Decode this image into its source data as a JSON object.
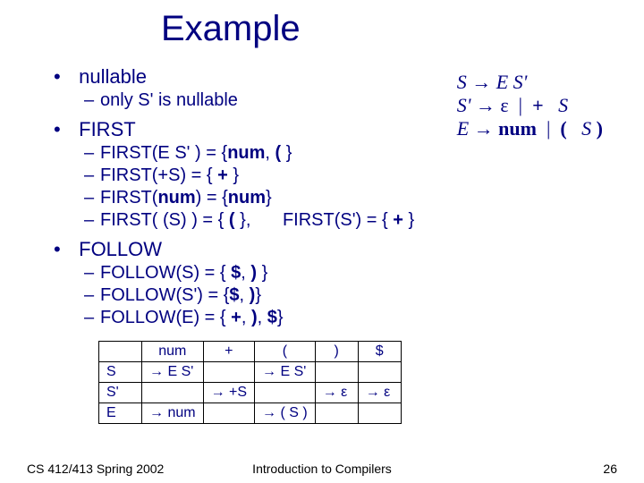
{
  "title": "Example",
  "grammar": {
    "line1_lhs": "S",
    "line1_rhs": "E S'",
    "line2_lhs": "S'",
    "line2_rhs1": "ε",
    "line2_rhs2": "+  S",
    "line3_lhs": "E",
    "line3_rhs1": "num",
    "line3_rhs2": "(  S )"
  },
  "bullets": {
    "nullable": "nullable",
    "nullable_sub": "only S' is nullable",
    "first": "FIRST",
    "first_items": {
      "a": "FIRST(E S' ) = {num, ( }",
      "b": "FIRST(+S) = { + }",
      "c": "FIRST(num) = {num}",
      "d_left": "FIRST( (S) ) = { ( },",
      "d_right": "FIRST(S') = { + }"
    },
    "follow": "FOLLOW",
    "follow_items": {
      "a": "FOLLOW(S) = { $, ) }",
      "b": "FOLLOW(S') = {$, )}",
      "c": "FOLLOW(E) = { +, ), $}"
    }
  },
  "table": {
    "headers": [
      "",
      "num",
      "+",
      "(",
      ")",
      "$"
    ],
    "rows": [
      {
        "hdr": "S",
        "cells": [
          "→ E S'",
          "",
          "→ E S'",
          "",
          ""
        ]
      },
      {
        "hdr": "S'",
        "cells": [
          "",
          "→ +S",
          "",
          "→ ε",
          "→ ε"
        ]
      },
      {
        "hdr": "E",
        "cells": [
          "→ num",
          "",
          "→ ( S )",
          "",
          ""
        ]
      }
    ]
  },
  "footer": {
    "left": "CS 412/413   Spring 2002",
    "mid": "Introduction to Compilers",
    "right": "26"
  }
}
